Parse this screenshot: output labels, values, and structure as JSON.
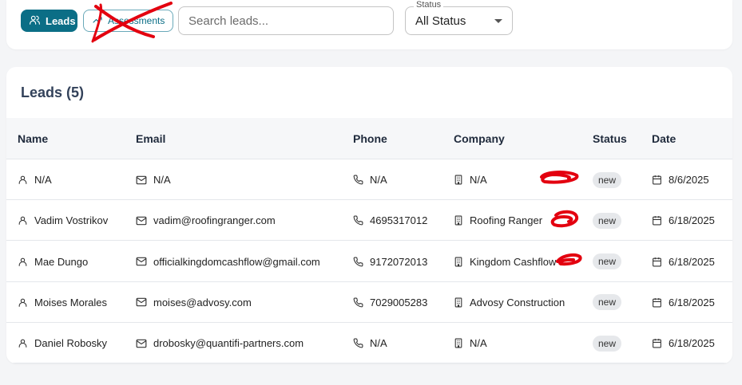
{
  "toolbar": {
    "tabs": [
      {
        "label": "Leads",
        "icon": "users-icon",
        "active": true
      },
      {
        "label": "Assessments",
        "icon": "trending-up-icon",
        "active": false
      }
    ],
    "search_placeholder": "Search leads...",
    "status_filter": {
      "label": "Status",
      "value": "All Status"
    }
  },
  "table": {
    "title": "Leads (5)",
    "columns": [
      "Name",
      "Email",
      "Phone",
      "Company",
      "Status",
      "Date"
    ],
    "rows": [
      {
        "name": "N/A",
        "email": "N/A",
        "phone": "N/A",
        "company": "N/A",
        "status": "new",
        "date": "8/6/2025"
      },
      {
        "name": "Vadim Vostrikov",
        "email": "vadim@roofingranger.com",
        "phone": "4695317012",
        "company": "Roofing Ranger",
        "status": "new",
        "date": "6/18/2025"
      },
      {
        "name": "Mae Dungo",
        "email": "officialkingdomcashflow@gmail.com",
        "phone": "9172072013",
        "company": "Kingdom Cashflow",
        "status": "new",
        "date": "6/18/2025"
      },
      {
        "name": "Moises Morales",
        "email": "moises@advosy.com",
        "phone": "7029005283",
        "company": "Advosy Construction",
        "status": "new",
        "date": "6/18/2025"
      },
      {
        "name": "Daniel Robosky",
        "email": "drobosky@quantifi-partners.com",
        "phone": "N/A",
        "company": "N/A",
        "status": "new",
        "date": "6/18/2025"
      }
    ]
  },
  "colors": {
    "accent": "#0b6e86",
    "annotation": "#e3000f"
  }
}
